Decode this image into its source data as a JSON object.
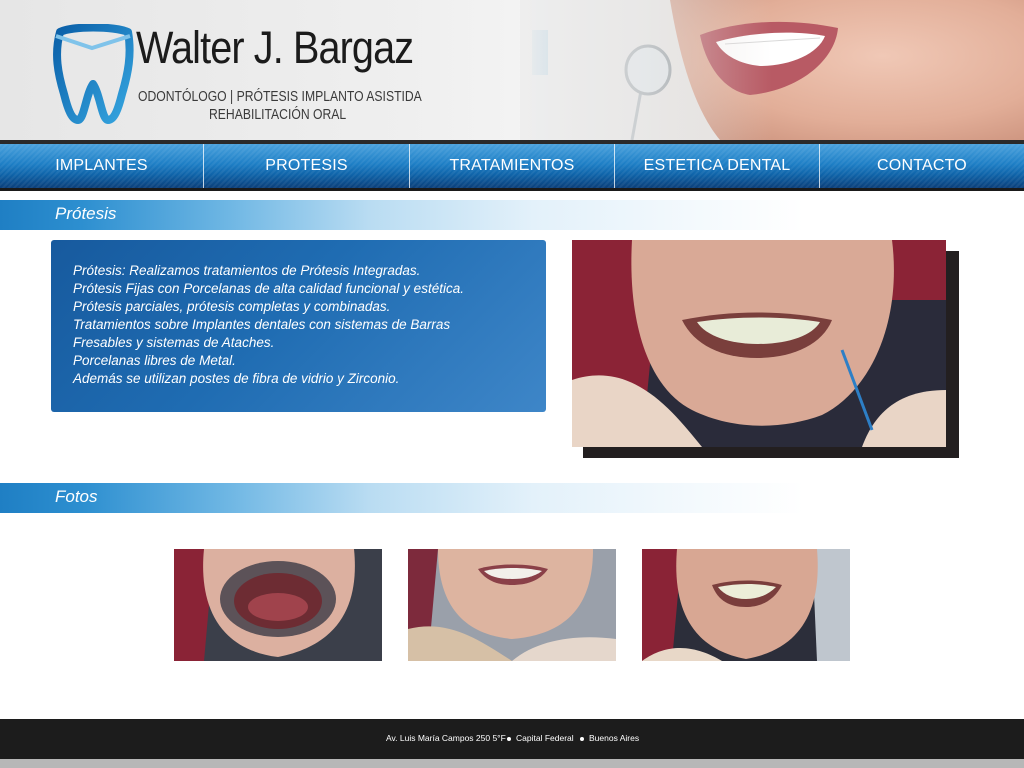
{
  "header": {
    "brand_name": "Walter J. Bargaz",
    "tagline_line1": "ODONTÓLOGO | PRÓTESIS IMPLANTO ASISTIDA",
    "tagline_line2": "REHABILITACIÓN ORAL",
    "icons": [
      "tooth-logo-icon"
    ]
  },
  "nav": {
    "items": [
      {
        "label": "IMPLANTES"
      },
      {
        "label": "PROTESIS"
      },
      {
        "label": "TRATAMIENTOS"
      },
      {
        "label": "ESTETICA DENTAL"
      },
      {
        "label": "CONTACTO"
      }
    ]
  },
  "sections": {
    "protesis": {
      "title": "Prótesis",
      "lines": [
        "Prótesis: Realizamos tratamientos de Prótesis Integradas.",
        "Prótesis Fijas con Porcelanas de alta calidad funcional y estética.",
        "Prótesis parciales, prótesis completas y combinadas.",
        "Tratamientos sobre Implantes dentales con sistemas de Barras",
        "Fresables y sistemas de Ataches.",
        "Porcelanas libres de Metal.",
        "Además se utilizan postes de fibra de vidrio y Zirconio."
      ]
    },
    "fotos": {
      "title": "Fotos"
    }
  },
  "footer": {
    "address": "Av. Luis María Campos 250 5°F",
    "city": "Capital Federal",
    "province": "Buenos Aires"
  },
  "colors": {
    "accent": "#1f7fc4",
    "panel": "#1f6cb2",
    "footer": "#1c1c1c"
  }
}
